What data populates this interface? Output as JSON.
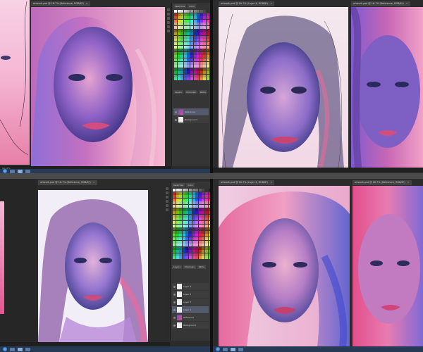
{
  "screens": [
    {
      "tab_title": "artwork.psd @ 16.7% (Reference, RGB/8*)",
      "close_glyph": "×",
      "zoom": "16.67%",
      "panel_tabs": [
        "Swatches",
        "Color"
      ],
      "layers_tabs": [
        "Layers",
        "Channels",
        "Paths"
      ],
      "layers": [
        "Reference",
        "Background"
      ]
    },
    {
      "tab_title": "artwork.psd @ 16.7% (Layer 4, RGB/8*)",
      "tab2_title": "artwork.psd @ 16.7% (Reference, RGB/8*)",
      "close_glyph": "×"
    },
    {
      "tab_title": "artwork.psd @ 16.7% (Reference, RGB/8*)",
      "close_glyph": "×",
      "panel_tabs": [
        "Swatches",
        "Color"
      ],
      "layers_tabs": [
        "Layers",
        "Channels",
        "Paths"
      ],
      "layers": [
        "Layer 4",
        "Layer 3",
        "Layer 2",
        "Layer 1",
        "Reference",
        "Background"
      ]
    },
    {
      "tab_title": "artwork.psd @ 16.7% (Layer 4, RGB/8*)",
      "tab2_title": "artwork.psd @ 16.7% (Reference, RGB/8*)",
      "close_glyph": "×"
    }
  ],
  "colors": {
    "pink": "#e8558f",
    "violet": "#6a4fc8",
    "blue": "#5869d8",
    "canvas_white": "#f4eef6",
    "panel_bg": "#353535",
    "taskbar": "#263a55"
  },
  "icons": [
    "start-orb-icon",
    "taskbar-app-icon",
    "eye-icon",
    "photoshop-tool-icon"
  ]
}
